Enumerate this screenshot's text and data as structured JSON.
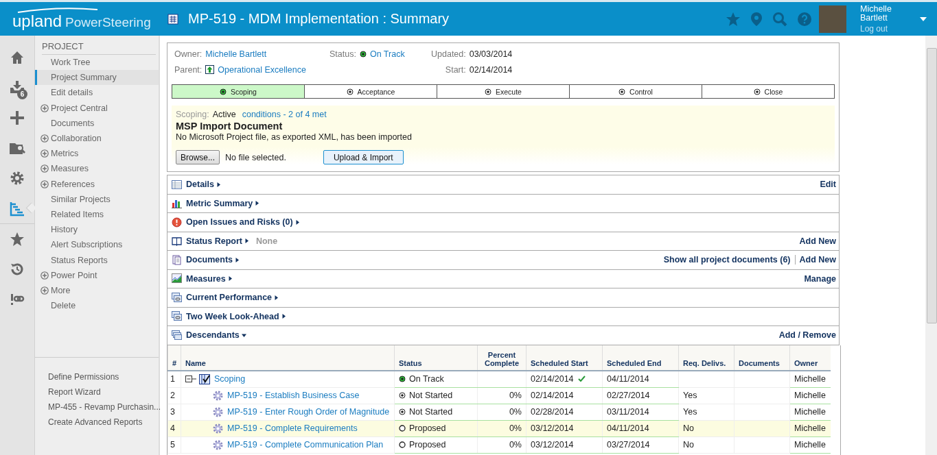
{
  "header": {
    "logo_main": "upland",
    "logo_sub": "PowerSteering",
    "title": "MP-519 - MDM Implementation : Summary",
    "user_name": "Michelle Bartlett",
    "logout": "Log out"
  },
  "rail": [
    {
      "kind": "home",
      "selected": false
    },
    {
      "kind": "inbox",
      "selected": false,
      "badge": "6"
    },
    {
      "kind": "plus",
      "selected": false
    },
    {
      "kind": "folder-search",
      "selected": false
    },
    {
      "kind": "gear",
      "selected": false
    },
    {
      "kind": "tree",
      "selected": true
    },
    {
      "kind": "star",
      "selected": false
    },
    {
      "kind": "history",
      "selected": false
    },
    {
      "kind": "link",
      "selected": false
    }
  ],
  "nav": {
    "heading": "PROJECT",
    "items": [
      {
        "label": "Work Tree",
        "expandable": false,
        "selected": false
      },
      {
        "label": "Project Summary",
        "expandable": false,
        "selected": true
      },
      {
        "label": "Edit details",
        "expandable": false,
        "selected": false
      },
      {
        "label": "Project Central",
        "expandable": true,
        "selected": false
      },
      {
        "label": "Documents",
        "expandable": false,
        "selected": false
      },
      {
        "label": "Collaboration",
        "expandable": true,
        "selected": false
      },
      {
        "label": "Metrics",
        "expandable": true,
        "selected": false
      },
      {
        "label": "Measures",
        "expandable": true,
        "selected": false
      },
      {
        "label": "References",
        "expandable": true,
        "selected": false
      },
      {
        "label": "Similar Projects",
        "expandable": false,
        "selected": false
      },
      {
        "label": "Related Items",
        "expandable": false,
        "selected": false
      },
      {
        "label": "History",
        "expandable": false,
        "selected": false
      },
      {
        "label": "Alert Subscriptions",
        "expandable": false,
        "selected": false
      },
      {
        "label": "Status Reports",
        "expandable": false,
        "selected": false
      },
      {
        "label": "Power Point",
        "expandable": true,
        "selected": false
      },
      {
        "label": "More",
        "expandable": true,
        "selected": false
      },
      {
        "label": "Delete",
        "expandable": false,
        "selected": false
      }
    ],
    "bottom_links": [
      "Define Permissions",
      "Report Wizard",
      "MP-455 - Revamp Purchasin...",
      "Create Advanced Reports"
    ]
  },
  "summary": {
    "owner_label": "Owner:",
    "owner": "Michelle Bartlett",
    "status_label": "Status:",
    "status": "On Track",
    "updated_label": "Updated:",
    "updated": "03/03/2014",
    "parent_label": "Parent:",
    "parent": "Operational Excellence",
    "start_label": "Start:",
    "start": "02/14/2014",
    "phases": [
      {
        "label": "Scoping",
        "selected": true
      },
      {
        "label": "Acceptance",
        "selected": false
      },
      {
        "label": "Execute",
        "selected": false
      },
      {
        "label": "Control",
        "selected": false
      },
      {
        "label": "Close",
        "selected": false
      }
    ],
    "gate_label": "Scoping:",
    "gate_state": "Active",
    "conditions": "conditions - 2 of 4 met",
    "import_title": "MSP Import Document",
    "import_note": "No Microsoft Project file, as exported XML, has been imported",
    "browse": "Browse...",
    "file_status": "No file selected.",
    "upload": "Upload & Import"
  },
  "sections": [
    {
      "kind": "table",
      "title": "Details",
      "actions": [
        "Edit"
      ]
    },
    {
      "kind": "bars",
      "title": "Metric Summary"
    },
    {
      "kind": "alert",
      "title": "Open Issues and Risks (0)"
    },
    {
      "kind": "book",
      "title": "Status Report",
      "note": "None",
      "actions": [
        "Add New"
      ]
    },
    {
      "kind": "doc",
      "title": "Documents",
      "actions": [
        "Show all project documents (6)",
        "Add New"
      ]
    },
    {
      "kind": "chart",
      "title": "Measures",
      "actions": [
        "Manage"
      ]
    },
    {
      "kind": "cards",
      "title": "Current Performance"
    },
    {
      "kind": "cards",
      "title": "Two Week Look-Ahead"
    },
    {
      "kind": "stack",
      "title": "Descendants",
      "actions": [
        "Add / Remove"
      ],
      "expanded": true
    }
  ],
  "descendants": {
    "columns": [
      "#",
      "Name",
      "Status",
      "Percent Complete",
      "Scheduled Start",
      "Scheduled End",
      "Req. Delivs.",
      "Documents",
      "Owner"
    ],
    "rows": [
      {
        "num": "1",
        "name": "Scoping",
        "kind": "phase",
        "expanded": true,
        "status": {
          "label": "On Track",
          "kind": "on_track"
        },
        "start": "02/14/2014",
        "start_met": true,
        "end": "04/11/2014",
        "owner": "Michelle",
        "highlighted": false,
        "children": [
          {
            "num": "2",
            "name": "MP-519 - Establish Business Case",
            "kind": "task",
            "status": {
              "label": "Not Started",
              "kind": "not_started"
            },
            "percent": "0%",
            "start": "02/14/2014",
            "start_met": false,
            "end": "02/27/2014",
            "req": "Yes",
            "owner": "Michelle",
            "highlighted": false
          },
          {
            "num": "3",
            "name": "MP-519 - Enter Rough Order of Magnitude",
            "kind": "task",
            "status": {
              "label": "Not Started",
              "kind": "not_started"
            },
            "percent": "0%",
            "start": "02/28/2014",
            "start_met": false,
            "end": "03/11/2014",
            "req": "Yes",
            "owner": "Michelle",
            "highlighted": false
          },
          {
            "num": "4",
            "name": "MP-519 - Complete Requirements",
            "kind": "task",
            "status": {
              "label": "Proposed",
              "kind": "proposed"
            },
            "percent": "0%",
            "start": "03/12/2014",
            "start_met": false,
            "end": "04/11/2014",
            "req": "No",
            "owner": "Michelle",
            "highlighted": true
          },
          {
            "num": "5",
            "name": "MP-519 - Complete Communication Plan",
            "kind": "task",
            "status": {
              "label": "Proposed",
              "kind": "proposed"
            },
            "percent": "0%",
            "start": "03/12/2014",
            "start_met": false,
            "end": "03/27/2014",
            "req": "No",
            "owner": "Michelle",
            "highlighted": false
          }
        ]
      }
    ]
  }
}
